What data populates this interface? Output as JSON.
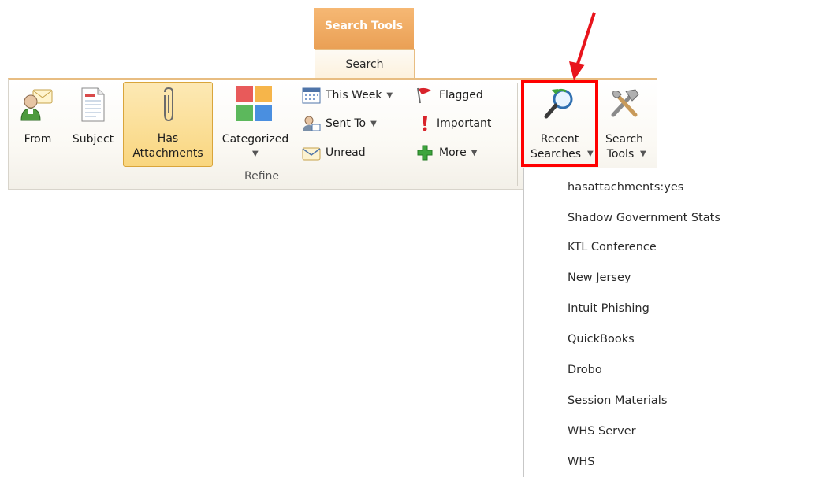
{
  "contextual_tab": {
    "group": "Search Tools",
    "tab": "Search"
  },
  "refine": {
    "group_label": "Refine",
    "from": "From",
    "subject": "Subject",
    "has_attachments": [
      "Has",
      "Attachments"
    ],
    "categorized": "Categorized",
    "this_week": "This Week",
    "sent_to": "Sent To",
    "unread": "Unread",
    "flagged": "Flagged",
    "important": "Important",
    "more": "More"
  },
  "options": {
    "recent_searches": [
      "Recent",
      "Searches"
    ],
    "search_tools": [
      "Search",
      "Tools"
    ]
  },
  "recent_searches_menu": [
    "hasattachments:yes",
    "Shadow Government Stats",
    "KTL Conference",
    "New Jersey",
    "Intuit Phishing",
    "QuickBooks",
    "Drobo",
    "Session Materials",
    "WHS Server",
    "WHS"
  ],
  "colors": {
    "context_header": "#eaa055",
    "highlight": "#ff0000",
    "selected_button": "#f9d67f"
  }
}
